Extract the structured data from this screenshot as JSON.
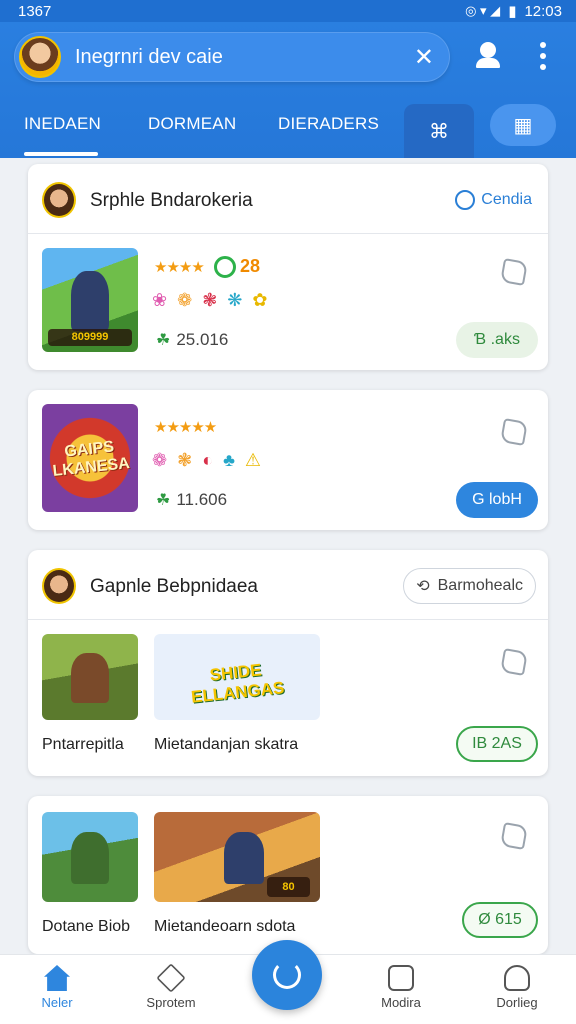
{
  "status_bar": {
    "time_left": "1367",
    "time_right": "12:03"
  },
  "header": {
    "search_text": "Inegrnri dev caie",
    "close_glyph": "✕"
  },
  "tabs": [
    {
      "label": "INEDAEN",
      "active": true
    },
    {
      "label": "DORMEAN"
    },
    {
      "label": "DIERADERS"
    }
  ],
  "sections": [
    {
      "title": "Srphle Bndarokeria",
      "link_label": "Cendia",
      "items": [
        {
          "thumb_label": "809999",
          "rating_text": "★★★★",
          "rating_extra": "28",
          "emojis": [
            "❀",
            "❁",
            "❃",
            "❋",
            "✿"
          ],
          "downloads": "25.016",
          "action": "Ɓ .aks"
        }
      ]
    },
    {
      "items": [
        {
          "thumb_label": "GAIPS LKANESA",
          "rating_text": "★★★★★",
          "emojis": [
            "❁",
            "❃",
            "◐",
            "♣",
            "⚠"
          ],
          "downloads": "11.606",
          "action": "G lobH"
        }
      ]
    },
    {
      "title": "Gapnle Bebpnidaea",
      "link_label": "Barmohealc",
      "games": [
        {
          "caption": "Pntarrepitla"
        },
        {
          "caption": "Mietandanjan skatra",
          "thumb_label": "SHIDE ELLANGAS"
        }
      ],
      "action": "IB 2AS"
    },
    {
      "games": [
        {
          "caption": "Dotane Biob"
        },
        {
          "caption": "Mietandeoarn sdota",
          "thumb_label": "80"
        }
      ],
      "action": "Ø 615"
    }
  ],
  "bottom_nav": [
    {
      "label": "Neler",
      "active": true
    },
    {
      "label": "Sprotem"
    },
    {
      "label": "Modira"
    },
    {
      "label": "Dorlieg"
    }
  ],
  "colors": {
    "primary": "#2a7fe0",
    "accent_green": "#2f8a3d",
    "star": "#f39c12"
  }
}
